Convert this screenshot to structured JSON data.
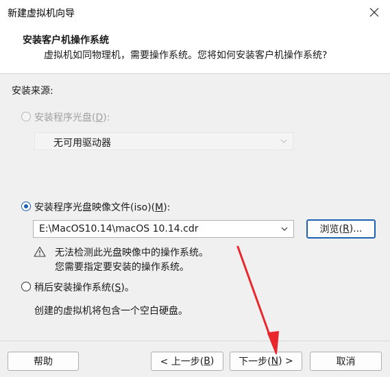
{
  "window": {
    "title": "新建虚拟机向导",
    "close_icon": "close-icon"
  },
  "header": {
    "title": "安装客户机操作系统",
    "subtitle": "虚拟机如同物理机，需要操作系统。您将如何安装客户机操作系统?"
  },
  "install_source": {
    "group_label": "安装来源:",
    "disc_option": {
      "label_prefix": "安装程序光盘(",
      "accel": "D",
      "label_suffix": "):",
      "selected": false,
      "enabled": false
    },
    "disc_drive": {
      "value": "无可用驱动器",
      "enabled": false
    },
    "iso_option": {
      "label_prefix": "安装程序光盘映像文件(iso)(",
      "accel": "M",
      "label_suffix": "):",
      "selected": true
    },
    "iso_path": {
      "value": "E:\\MacOS10.14\\macOS 10.14.cdr"
    },
    "browse_button": {
      "label_prefix": "浏览(",
      "accel": "R",
      "label_suffix": ")..."
    },
    "warning": {
      "icon": "warning-triangle-icon",
      "line1": "无法检测此光盘映像中的操作系统。",
      "line2": "您需要指定要安装的操作系统。"
    },
    "later_option": {
      "label_prefix": "稍后安装操作系统(",
      "accel": "S",
      "label_suffix": ")。",
      "selected": false
    },
    "later_note": "创建的虚拟机将包含一个空白硬盘。"
  },
  "footer": {
    "help": "帮助",
    "back_prefix": "< 上一步(",
    "back_accel": "B",
    "back_suffix": ")",
    "next_prefix": "下一步(",
    "next_accel": "N",
    "next_suffix": ") >",
    "cancel": "取消"
  },
  "colors": {
    "accent": "#1a5fb4",
    "annotation_arrow": "#e8262b"
  }
}
